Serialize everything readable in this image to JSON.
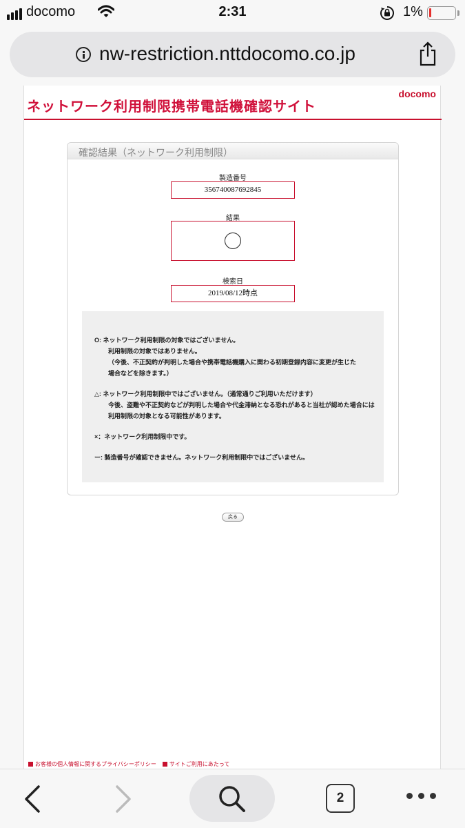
{
  "status_bar": {
    "carrier": "docomo",
    "time": "2:31",
    "battery_percent": "1%",
    "signal_bars": 4,
    "wifi_icon": "wifi-icon",
    "orientation_lock_icon": "orientation-lock-icon"
  },
  "url_bar": {
    "domain": "nw-restriction.nttdocomo.co.jp",
    "info_icon": "info-icon",
    "share_icon": "share-icon"
  },
  "page": {
    "site_title": "ネットワーク利用制限携帯電話機確認サイト",
    "logo_text": "docomo",
    "panel_title": "確認結果（ネットワーク利用制限）",
    "serial_label": "製造番号",
    "serial_value": "356740087692845",
    "result_label": "結果",
    "result_symbol": "circle",
    "date_label": "検索日",
    "date_value": "2019/08/12時点",
    "legend": {
      "circle_line1": "O: ネットワーク利用制限の対象ではございません。",
      "circle_line2": "利用制限の対象ではありません。",
      "circle_line3": "（今後、不正契約が判明した場合や携帯電話機購入に関わる初期登録内容に変更が生じた",
      "circle_line4": "場合などを除きます。）",
      "triangle_line1": "△: ネットワーク利用制限中ではございません。（通常通りご利用いただけます）",
      "triangle_line2": "今後、盗難や不正契約などが判明した場合や代金滞納となる恐れがあると当社が認めた場合には",
      "triangle_line3": "利用制限の対象となる可能性があります。",
      "cross_line": "×：ネットワーク利用制限中です。",
      "dash_line": "ー: 製造番号が確認できません。ネットワーク利用制限中ではございません。"
    },
    "back_button": "戻る",
    "footer_link1": "お客様の個人情報に関するプライバシーポリシー",
    "footer_link2": "サイトご利用にあたって"
  },
  "toolbar": {
    "tabs_count": "2",
    "back_icon": "chevron-left-icon",
    "forward_icon": "chevron-right-icon",
    "search_icon": "search-icon",
    "more_icon": "more-icon"
  },
  "colors": {
    "brand_red": "#c8102e",
    "title_red": "#d0103a",
    "battery_low": "#e5302d"
  }
}
